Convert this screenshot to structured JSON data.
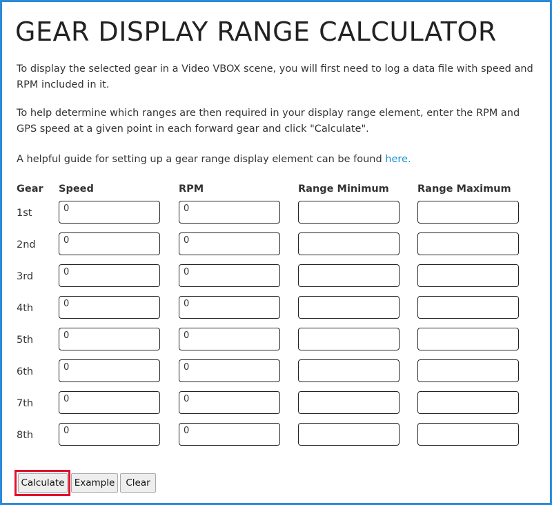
{
  "page": {
    "title": "GEAR DISPLAY RANGE CALCULATOR",
    "intro_1": "To display the selected gear in a Video VBOX scene, you will first need to log a data file with speed and RPM included in it.",
    "intro_2": "To help determine which ranges are then required in your display range element, enter the RPM and GPS speed at a given point in each forward gear and click \"Calculate\".",
    "intro_3_text": "A helpful guide for setting up a gear range display element can be found ",
    "intro_3_link": "here."
  },
  "table": {
    "headers": {
      "gear": "Gear",
      "speed": "Speed",
      "rpm": "RPM",
      "range_min": "Range Minimum",
      "range_max": "Range Maximum"
    },
    "rows": [
      {
        "gear": "1st",
        "speed": "0",
        "rpm": "0",
        "range_min": "",
        "range_max": ""
      },
      {
        "gear": "2nd",
        "speed": "0",
        "rpm": "0",
        "range_min": "",
        "range_max": ""
      },
      {
        "gear": "3rd",
        "speed": "0",
        "rpm": "0",
        "range_min": "",
        "range_max": ""
      },
      {
        "gear": "4th",
        "speed": "0",
        "rpm": "0",
        "range_min": "",
        "range_max": ""
      },
      {
        "gear": "5th",
        "speed": "0",
        "rpm": "0",
        "range_min": "",
        "range_max": ""
      },
      {
        "gear": "6th",
        "speed": "0",
        "rpm": "0",
        "range_min": "",
        "range_max": ""
      },
      {
        "gear": "7th",
        "speed": "0",
        "rpm": "0",
        "range_min": "",
        "range_max": ""
      },
      {
        "gear": "8th",
        "speed": "0",
        "rpm": "0",
        "range_min": "",
        "range_max": ""
      }
    ]
  },
  "buttons": {
    "calculate": "Calculate",
    "example": "Example",
    "clear": "Clear"
  },
  "colors": {
    "frame_border": "#2b8bd9",
    "link": "#1a8fd6",
    "highlight": "#e0112b"
  }
}
